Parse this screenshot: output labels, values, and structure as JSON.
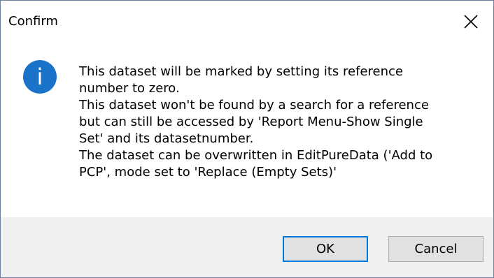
{
  "window": {
    "title": "Confirm",
    "close_icon": "close-icon"
  },
  "icon": {
    "name": "information-icon",
    "glyph": "i",
    "color": "#1a73c9"
  },
  "message": {
    "lines": [
      "This dataset will be marked by setting its reference",
      "number to zero.",
      "This dataset won't be found by a search for a reference",
      "but can still be accessed by 'Report Menu-Show Single",
      "Set' and its datasetnumber.",
      "The dataset can be overwritten in EditPureData ('Add to",
      "PCP', mode set to 'Replace (Empty Sets)'"
    ]
  },
  "buttons": {
    "ok_label": "OK",
    "cancel_label": "Cancel"
  },
  "colors": {
    "accent": "#0078d7",
    "footer_bg": "#f0f0f0",
    "button_bg": "#e1e1e1"
  }
}
